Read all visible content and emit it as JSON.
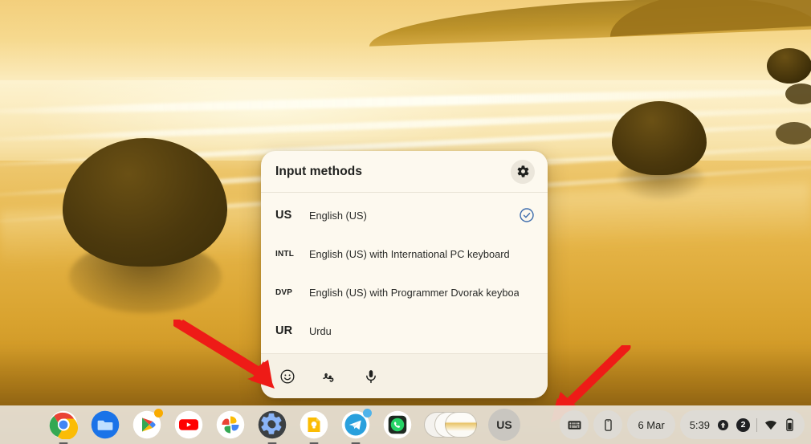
{
  "wallpaper": {
    "name": "sunset-beach-boulders-wallpaper"
  },
  "panel": {
    "title": "Input methods",
    "settings_icon": "gear-icon",
    "methods": [
      {
        "abbr": "US",
        "abbr_size": "big",
        "label": "English (US)",
        "selected": true
      },
      {
        "abbr": "INTL",
        "abbr_size": "small",
        "label": "English (US) with International PC keyboard",
        "selected": false
      },
      {
        "abbr": "DVP",
        "abbr_size": "small",
        "label": "English (US) with Programmer Dvorak keyboard",
        "selected": false
      },
      {
        "abbr": "UR",
        "abbr_size": "big",
        "label": "Urdu",
        "selected": false
      }
    ],
    "footer_tools": [
      {
        "icon": "emoji-icon",
        "label": "Emoji"
      },
      {
        "icon": "handwriting-icon",
        "label": "Handwriting"
      },
      {
        "icon": "microphone-icon",
        "label": "Voice input"
      }
    ],
    "check_color": "#3f6ead"
  },
  "annotations": [
    {
      "name": "arrow-to-emoji-button",
      "color": "#ee1b17"
    },
    {
      "name": "arrow-to-us-shelf-button",
      "color": "#ee1b17"
    }
  ],
  "shelf": {
    "apps": [
      {
        "name": "chrome",
        "label": "Google Chrome",
        "running": true,
        "badge": false
      },
      {
        "name": "files",
        "label": "Files",
        "running": false,
        "badge": false
      },
      {
        "name": "play-store",
        "label": "Play Store",
        "running": false,
        "badge": true
      },
      {
        "name": "youtube",
        "label": "YouTube",
        "running": false,
        "badge": false
      },
      {
        "name": "photos",
        "label": "Google Photos",
        "running": false,
        "badge": false
      },
      {
        "name": "settings",
        "label": "Settings",
        "running": true,
        "badge": false
      },
      {
        "name": "keep",
        "label": "Google Keep",
        "running": true,
        "badge": false
      },
      {
        "name": "telegram",
        "label": "Telegram",
        "running": true,
        "badge": true
      },
      {
        "name": "whatsapp",
        "label": "WhatsApp",
        "running": false,
        "badge": false
      }
    ],
    "window_previews_label": "Window previews",
    "input_method_button": "US"
  },
  "status": {
    "keyboard_icon": "keyboard-icon",
    "phone_hub_icon": "phone-icon",
    "date": "6 Mar",
    "time": "5:39",
    "update_icon": "update-available-icon",
    "notification_count": "2",
    "wifi_icon": "wifi-icon",
    "battery_icon": "battery-icon"
  }
}
